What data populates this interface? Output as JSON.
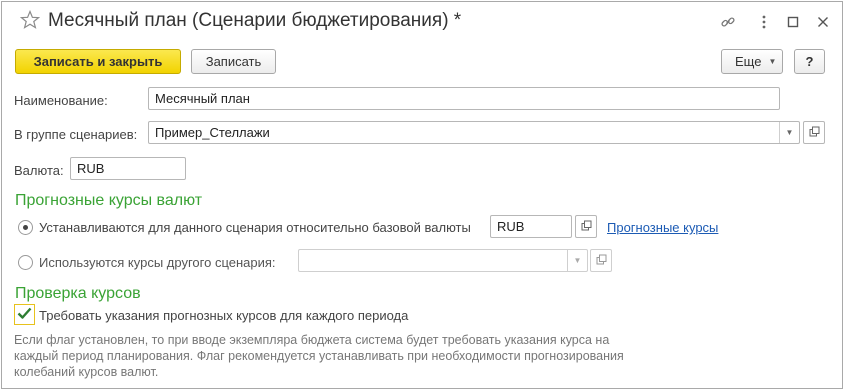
{
  "window": {
    "title": "Месячный план (Сценарии бюджетирования) *",
    "header_icons": [
      "star-icon",
      "link-icon",
      "more-vertical-icon",
      "maximize-icon",
      "close-icon"
    ]
  },
  "toolbar": {
    "save_close_label": "Записать и закрыть",
    "save_label": "Записать",
    "more_label": "Еще",
    "help_label": "?"
  },
  "form": {
    "name_label": "Наименование:",
    "name_value": "Месячный план",
    "group_label": "В группе сценариев:",
    "group_value": "Пример_Стеллажи",
    "currency_label": "Валюта:",
    "currency_value": "RUB"
  },
  "forecast": {
    "section_title": "Прогнозные курсы валют",
    "option1_label": "Устанавливаются для данного сценария относительно базовой валюты",
    "option1_selected": true,
    "option1_currency": "RUB",
    "forecast_link": "Прогнозные курсы",
    "option2_label": "Используются курсы другого сценария:",
    "option2_selected": false,
    "option2_value": ""
  },
  "check": {
    "section_title": "Проверка курсов",
    "checkbox_label": "Требовать указания прогнозных курсов для каждого периода",
    "checkbox_checked": true,
    "hint_line1": "Если флаг установлен, то при вводе экземпляра бюджета система будет требовать указания курса на",
    "hint_line2": "каждый период планирования. Флаг рекомендуется устанавливать при необходимости прогнозирования",
    "hint_line3": "колебаний курсов валют."
  },
  "colors": {
    "accent_yellow": "#f2d300",
    "section_green": "#3aa335",
    "link_blue": "#1c5bb4"
  }
}
